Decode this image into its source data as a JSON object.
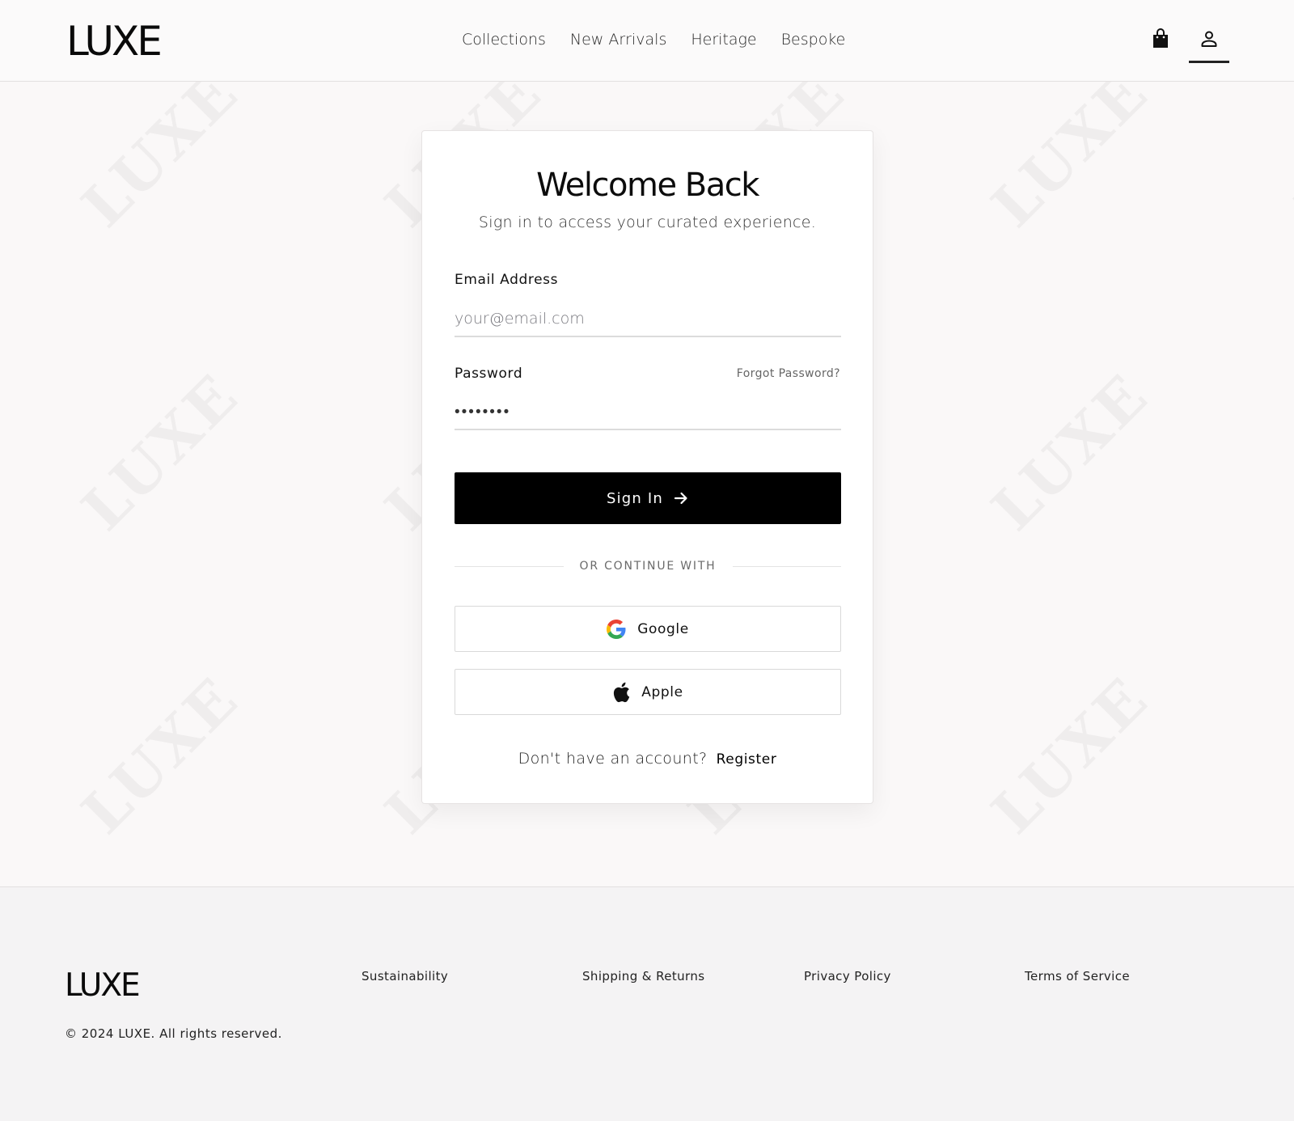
{
  "header": {
    "logo": "LUXE",
    "nav": [
      "Collections",
      "New Arrivals",
      "Heritage",
      "Bespoke"
    ],
    "icons": {
      "bag": "shopping-bag-icon",
      "account": "user-icon"
    }
  },
  "watermark": "LUXE",
  "login": {
    "title": "Welcome Back",
    "subtitle": "Sign in to access your curated experience.",
    "email_label": "Email Address",
    "email_placeholder": "your@email.com",
    "password_label": "Password",
    "forgot_label": "Forgot Password?",
    "password_value": "••••••••",
    "signin_label": "Sign In",
    "divider_text": "OR CONTINUE WITH",
    "google_label": "Google",
    "apple_label": "Apple",
    "register_question": "Don't have an account?",
    "register_link": "Register"
  },
  "footer": {
    "logo": "LUXE",
    "copyright": "© 2024 LUXE. All rights reserved.",
    "links": [
      "Sustainability",
      "Shipping & Returns",
      "Privacy Policy",
      "Terms of Service"
    ]
  },
  "colors": {
    "primary": "#000000",
    "background": "#faf8f8",
    "footer_bg": "#f4f3f4"
  }
}
